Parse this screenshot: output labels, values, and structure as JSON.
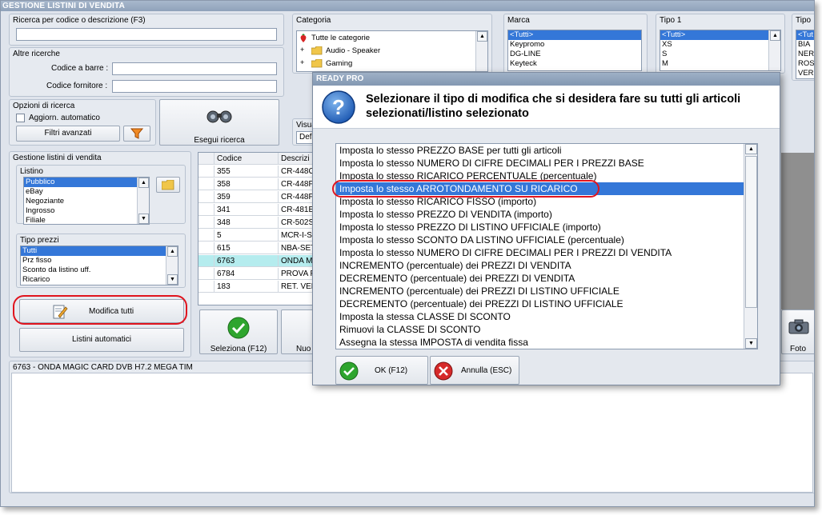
{
  "window": {
    "title": "GESTIONE LISTINI DI VENDITA"
  },
  "search": {
    "label": "Ricerca per codice o descrizione (F3)",
    "value": ""
  },
  "altre": {
    "label": "Altre ricerche",
    "barcode_label": "Codice a barre :",
    "fornitore_label": "Codice fornitore :",
    "barcode_value": "",
    "fornitore_value": ""
  },
  "opzioni": {
    "label": "Opzioni di ricerca",
    "aggiorn_label": "Aggiorn. automatico",
    "filtri_label": "Filtri avanzati",
    "esegui_label": "Esegui ricerca"
  },
  "categoria": {
    "label": "Categoria",
    "items": [
      "Tutte le categorie",
      "Audio - Speaker",
      "Gaming"
    ]
  },
  "marca": {
    "label": "Marca",
    "items": [
      "<Tutti>",
      "Keypromo",
      "DG-LINE",
      "Keyteck"
    ]
  },
  "tipo1": {
    "label": "Tipo 1",
    "items": [
      "<Tutti>",
      "XS",
      "S",
      "M"
    ]
  },
  "tipo2": {
    "label": "Tipo",
    "items": [
      "<Tut",
      "BIA",
      "NER",
      "ROS",
      "VER"
    ]
  },
  "visual": {
    "label": "Visua",
    "value": "Defa"
  },
  "gestione": {
    "label": "Gestione listini di vendita"
  },
  "listino": {
    "label": "Listino",
    "items": [
      "Pubblico",
      "eBay",
      "Negoziante",
      "Ingrosso",
      "Filiale"
    ]
  },
  "tipoprezzi": {
    "label": "Tipo prezzi",
    "items": [
      "Tutti",
      "Prz fisso",
      "Sconto da listino uff.",
      "Ricarico"
    ]
  },
  "buttons": {
    "modifica_tutti": "Modifica tutti",
    "listini_automatici": "Listini automatici",
    "seleziona": "Seleziona (F12)",
    "nuovo": "Nuo",
    "foto": "Foto"
  },
  "table": {
    "headers": [
      "Codice",
      "Descrizi"
    ],
    "rows": [
      [
        "355",
        "CR-448C"
      ],
      [
        "358",
        "CR-448F"
      ],
      [
        "359",
        "CR-448F"
      ],
      [
        "341",
        "CR-481E"
      ],
      [
        "348",
        "CR-502S"
      ],
      [
        "5",
        "MCR-I-S"
      ],
      [
        "615",
        "NBA-SET"
      ],
      [
        "6763",
        "ONDA M"
      ],
      [
        "6784",
        "PROVA F"
      ],
      [
        "183",
        "RET. VEL"
      ]
    ]
  },
  "detail": {
    "label": "6763 - ONDA MAGIC CARD DVB H7.2 MEGA TIM"
  },
  "dialog": {
    "title": "READY PRO",
    "message": "Selezionare il tipo di modifica che si desidera fare su tutti gli articoli selezionati/listino selezionato",
    "options": [
      "Imposta lo stesso PREZZO BASE per tutti gli articoli",
      "Imposta lo stesso NUMERO DI CIFRE DECIMALI PER I PREZZI BASE",
      "Imposta lo stesso RICARICO PERCENTUALE (percentuale)",
      "Imposta lo stesso ARROTONDAMENTO SU RICARICO",
      "Imposta lo stesso RICARICO FISSO (importo)",
      "Imposta lo stesso PREZZO DI VENDITA (importo)",
      "Imposta lo stesso PREZZO DI LISTINO UFFICIALE (importo)",
      "Imposta lo stesso SCONTO DA LISTINO UFFICIALE (percentuale)",
      "Imposta lo stesso NUMERO DI CIFRE DECIMALI PER I PREZZI DI VENDITA",
      "INCREMENTO (percentuale) dei PREZZI DI VENDITA",
      "DECREMENTO (percentuale) dei PREZZI DI VENDITA",
      "INCREMENTO (percentuale) dei PREZZI DI LISTINO UFFICIALE",
      "DECREMENTO (percentuale) dei PREZZI DI LISTINO UFFICIALE",
      "Imposta la stessa CLASSE DI SCONTO",
      "Rimuovi la CLASSE DI SCONTO",
      "Assegna la stessa IMPOSTA di vendita fissa"
    ],
    "ok_label": "OK (F12)",
    "cancel_label": "Annulla (ESC)"
  },
  "colors": {
    "selection": "#3477d8",
    "highlight_oval": "#e0141e",
    "title_bar": "#8fa2ba"
  }
}
